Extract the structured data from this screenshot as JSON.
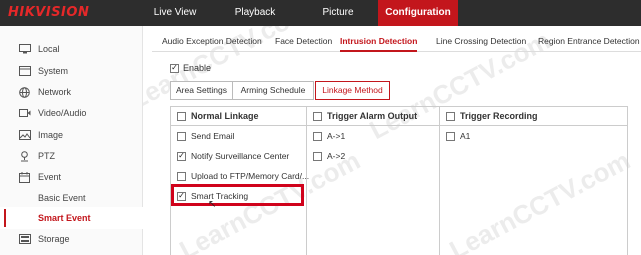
{
  "brand": "HIKVISION",
  "nav": [
    "Live View",
    "Playback",
    "Picture",
    "Configuration"
  ],
  "sidebar": [
    {
      "label": "Local",
      "icon": "monitor-icon"
    },
    {
      "label": "System",
      "icon": "system-icon"
    },
    {
      "label": "Network",
      "icon": "globe-icon"
    },
    {
      "label": "Video/Audio",
      "icon": "video-icon"
    },
    {
      "label": "Image",
      "icon": "image-icon"
    },
    {
      "label": "PTZ",
      "icon": "ptz-icon"
    },
    {
      "label": "Event",
      "icon": "calendar-icon"
    },
    {
      "label": "Basic Event"
    },
    {
      "label": "Smart Event"
    },
    {
      "label": "Storage",
      "icon": "storage-icon"
    }
  ],
  "tabs": [
    "Audio Exception Detection",
    "Face Detection",
    "Intrusion Detection",
    "Line Crossing Detection",
    "Region Entrance Detection"
  ],
  "enable": {
    "label": "Enable",
    "checked": true
  },
  "subtabs": [
    "Area Settings",
    "Arming Schedule",
    "Linkage Method"
  ],
  "columns": {
    "normal": {
      "header": "Normal Linkage",
      "items": [
        {
          "label": "Send Email",
          "checked": false
        },
        {
          "label": "Notify Surveillance Center",
          "checked": true
        },
        {
          "label": "Upload to FTP/Memory Card/...",
          "checked": false
        },
        {
          "label": "Smart Tracking",
          "checked": true
        }
      ]
    },
    "alarm": {
      "header": "Trigger Alarm Output",
      "items": [
        {
          "label": "A->1",
          "checked": false
        },
        {
          "label": "A->2",
          "checked": false
        }
      ]
    },
    "recording": {
      "header": "Trigger Recording",
      "items": [
        {
          "label": "A1",
          "checked": false
        }
      ]
    }
  },
  "watermark": "LearnCCTV.com",
  "colors": {
    "brand_red": "#c3161c",
    "topbar": "#2d2d2d",
    "highlight": "#d0021b"
  }
}
